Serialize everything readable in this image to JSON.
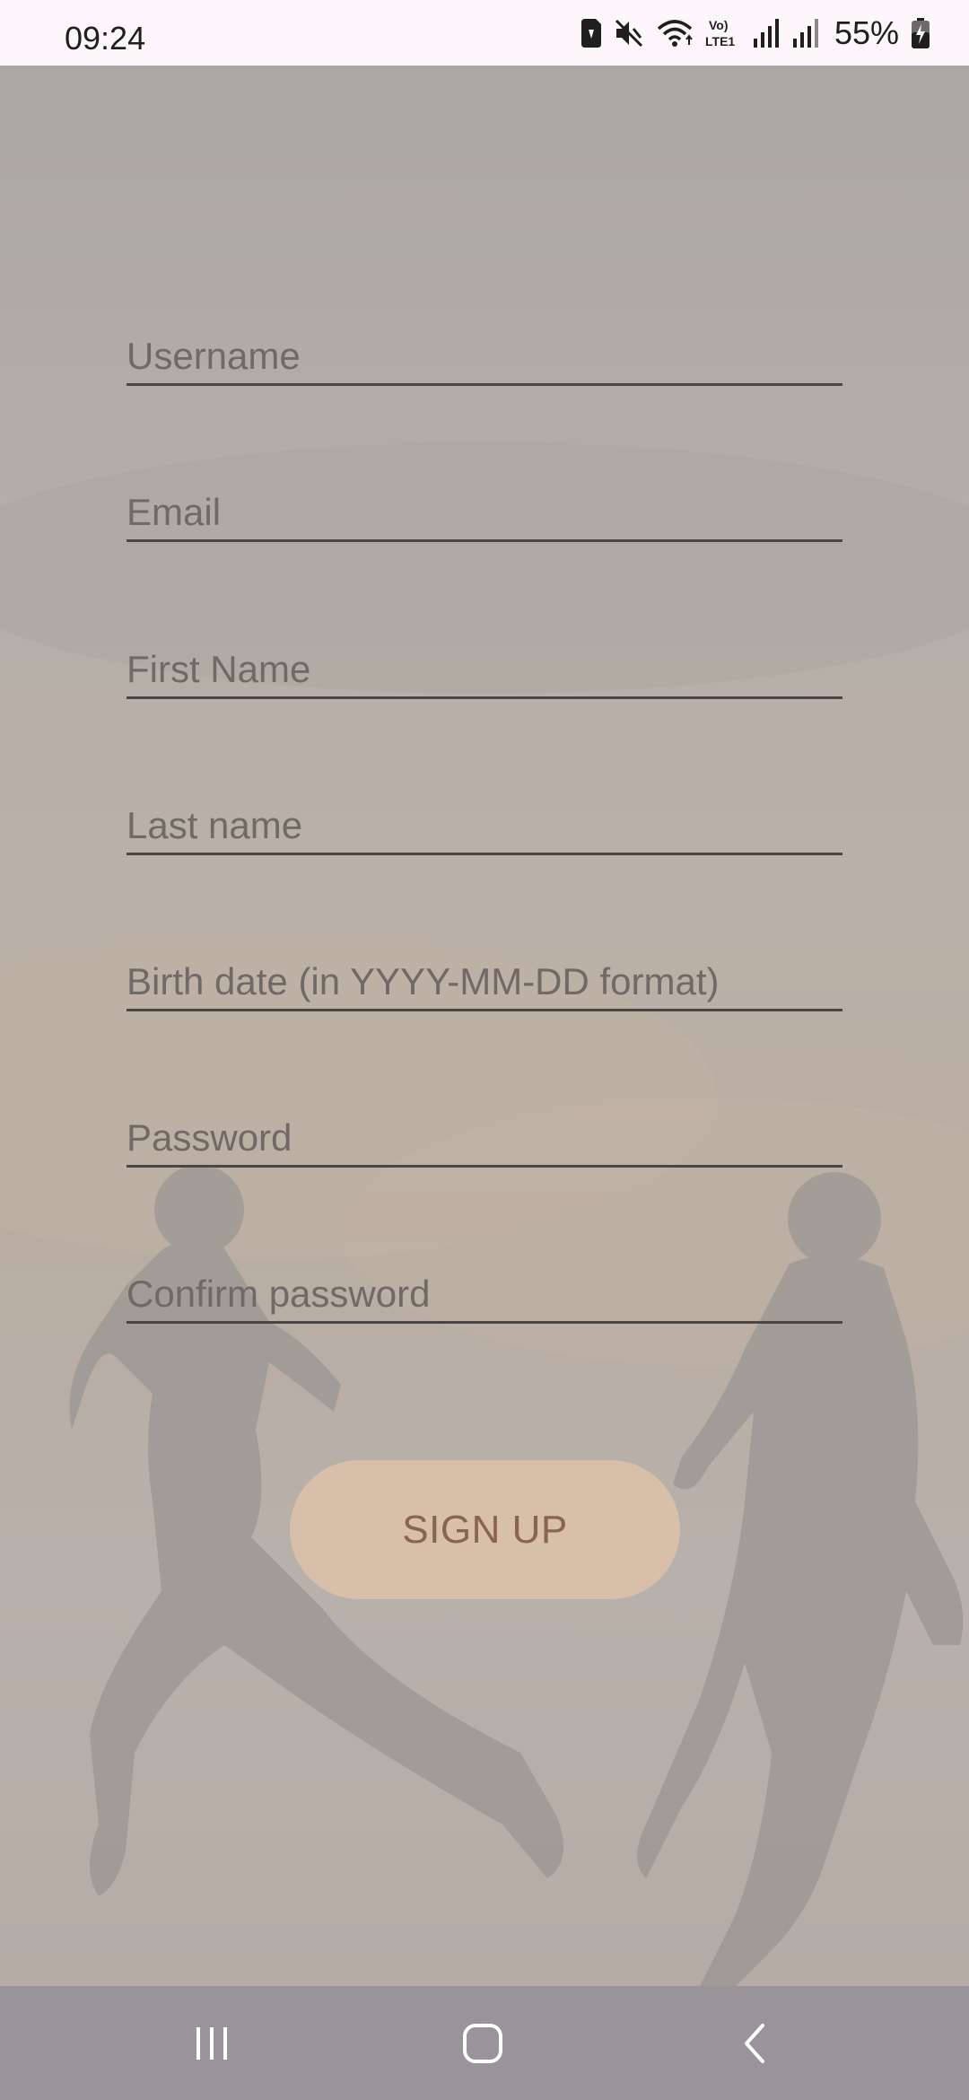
{
  "status_bar": {
    "time": "09:24",
    "battery_percent": "55%",
    "icons": [
      "sim-card-icon",
      "mute-icon",
      "wifi-icon",
      "volte-icon",
      "signal-icon",
      "signal-icon",
      "battery-charging-icon"
    ],
    "volte_line1": "Vo)",
    "volte_line2": "LTE1"
  },
  "form": {
    "username": {
      "placeholder": "Username",
      "value": ""
    },
    "email": {
      "placeholder": "Email",
      "value": ""
    },
    "first_name": {
      "placeholder": "First Name",
      "value": ""
    },
    "last_name": {
      "placeholder": "Last name",
      "value": ""
    },
    "birth_date": {
      "placeholder": "Birth date (in YYYY-MM-DD format)",
      "value": ""
    },
    "password": {
      "placeholder": "Password",
      "value": ""
    },
    "confirm_password": {
      "placeholder": "Confirm password",
      "value": ""
    },
    "signup_label": "SIGN UP"
  },
  "navigation": {
    "buttons": [
      "recent-apps-icon",
      "home-icon",
      "back-icon"
    ]
  },
  "colors": {
    "status_bar_bg": "#fdf7fc",
    "button_bg": "#d7bfa9",
    "button_text": "#8a6452",
    "nav_bar_bg": "#98949a",
    "underline": "#4a4646"
  }
}
